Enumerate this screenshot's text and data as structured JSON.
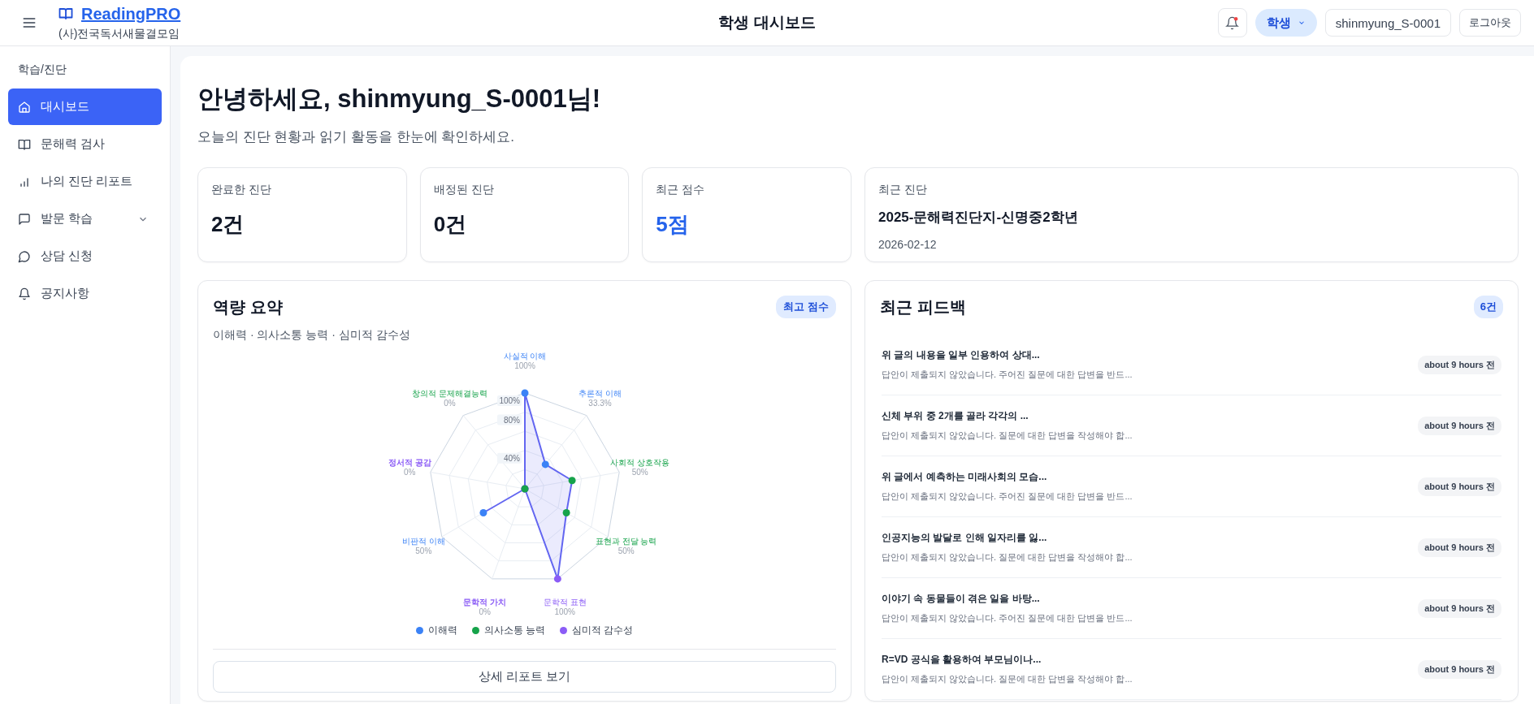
{
  "header": {
    "brand": "ReadingPRO",
    "organization": "(사)전국독서새물결모임",
    "title": "학생 대시보드",
    "has_notification": true,
    "role": "학생",
    "user": "shinmyung_S-0001",
    "logout": "로그아웃"
  },
  "sidebar": {
    "section": "학습/진단",
    "items": [
      {
        "label": "대시보드",
        "selected": true
      },
      {
        "label": "문해력 검사",
        "selected": false
      },
      {
        "label": "나의 진단 리포트",
        "selected": false
      },
      {
        "label": "발문 학습",
        "selected": false,
        "expandable": true
      },
      {
        "label": "상담 신청",
        "selected": false
      },
      {
        "label": "공지사항",
        "selected": false
      }
    ]
  },
  "greeting": {
    "title": "안녕하세요, shinmyung_S-0001님!",
    "subtitle": "오늘의 진단 현황과 읽기 활동을 한눈에 확인하세요."
  },
  "stats": [
    {
      "label": "완료한 진단",
      "value": "2건",
      "highlight": false
    },
    {
      "label": "배정된 진단",
      "value": "0건",
      "highlight": false
    },
    {
      "label": "최근 점수",
      "value": "5점",
      "highlight": true
    }
  ],
  "recent_diagnosis": {
    "label": "최근 진단",
    "name": "2025-문해력진단지-신명중2학년",
    "date": "2026-02-12"
  },
  "competency": {
    "title": "역량 요약",
    "badge": "최고 점수",
    "subtitle": "이해력 · 의사소통 능력 · 심미적 감수성",
    "button": "상세 리포트 보기",
    "chart_data": {
      "type": "radar",
      "categories": [
        "사실적 이해",
        "추론적 이해",
        "사회적 상호작용",
        "표현과 전달 능력",
        "문학적 표현",
        "문학적 가치",
        "비판적 이해",
        "정서적 공감",
        "창의적 문제해결능력"
      ],
      "value_labels": [
        "100%",
        "33.3%",
        "50%",
        "50%",
        "100%",
        "0%",
        "50%",
        "0%",
        "0%"
      ],
      "series": [
        {
          "color": "#6366f1",
          "values": [
            100,
            33.3,
            50,
            50,
            100,
            0,
            50,
            0,
            0
          ]
        }
      ],
      "ylim": [
        0,
        100
      ],
      "yticks": [
        {
          "value": 40,
          "label": "40%"
        },
        {
          "value": 80,
          "label": "80%"
        },
        {
          "value": 100,
          "label": "100%"
        }
      ]
    },
    "axes": [
      {
        "color": "#3b82f6"
      },
      {
        "color": "#3b82f6"
      },
      {
        "color": "#16a34a"
      },
      {
        "color": "#16a34a"
      },
      {
        "color": "#8b5cf6"
      },
      {
        "color": "#8b5cf6"
      },
      {
        "color": "#3b82f6"
      },
      {
        "color": "#8b5cf6"
      },
      {
        "color": "#16a34a"
      }
    ],
    "legend": [
      {
        "label": "이해력",
        "color": "#3b82f6"
      },
      {
        "label": "의사소통 능력",
        "color": "#16a34a"
      },
      {
        "label": "심미적 감수성",
        "color": "#8b5cf6"
      }
    ]
  },
  "feedback": {
    "title": "최근 피드백",
    "count": "6건",
    "items": [
      {
        "title": "위 글의 내용을 일부 인용하여 상대...",
        "text": "답안이 제출되지 않았습니다. 주어진 질문에 대한 답변을 반드...",
        "time": "about 9 hours 전"
      },
      {
        "title": "신체 부위 중 2개를 골라 각각의 ...",
        "text": "답안이 제출되지 않았습니다. 질문에 대한 답변을 작성해야 합...",
        "time": "about 9 hours 전"
      },
      {
        "title": "위 글에서 예측하는 미래사회의 모습...",
        "text": "답안이 제출되지 않았습니다. 주어진 질문에 대한 답변을 반드...",
        "time": "about 9 hours 전"
      },
      {
        "title": "인공지능의 발달로 인해 일자리를 잃...",
        "text": "답안이 제출되지 않았습니다. 질문에 대한 답변을 작성해야 합...",
        "time": "about 9 hours 전"
      },
      {
        "title": "이야기 속 동물들이 겪은 일을 바탕...",
        "text": "답안이 제출되지 않았습니다. 주어진 질문에 대한 답변을 반드...",
        "time": "about 9 hours 전"
      },
      {
        "title": "R=VD 공식을 활용하여 부모님이나...",
        "text": "답안이 제출되지 않았습니다. 질문에 대한 답변을 작성해야 합...",
        "time": "about 9 hours 전"
      }
    ]
  }
}
